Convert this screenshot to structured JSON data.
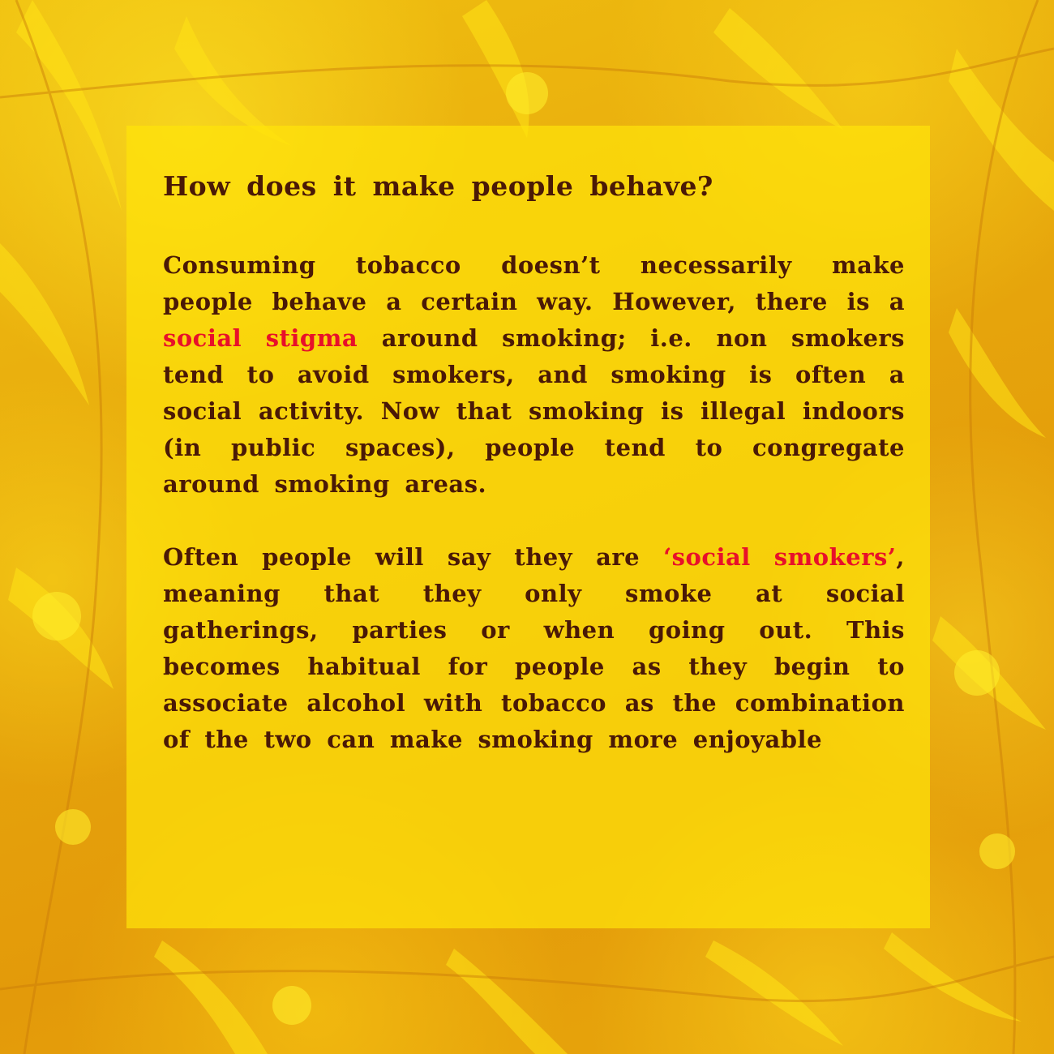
{
  "colors": {
    "text": "#4a1906",
    "highlight": "#e8102a",
    "panel": "#ffe40a",
    "background": "#e6a50c"
  },
  "background": {
    "decoration": "botanical-flower-illustration"
  },
  "heading": "How does it make people behave?",
  "paragraph1": {
    "part1": "Consuming tobacco doesn’t necessarily make people behave a certain way. However, there is a ",
    "highlight": "social stigma",
    "part2": " around smoking; i.e. non smokers tend to avoid smokers, and smoking is often a social activity. Now that smoking is illegal indoors (in public spaces), people tend to congregate around smoking areas."
  },
  "paragraph2": {
    "part1": "Often people will say they are ",
    "highlight": "‘social smokers’",
    "part2": ", meaning that they only smoke at social gatherings, parties or when going out. This becomes habitual for people as they begin to associate alcohol with tobacco as the combination of the two can make smoking more enjoyable"
  }
}
